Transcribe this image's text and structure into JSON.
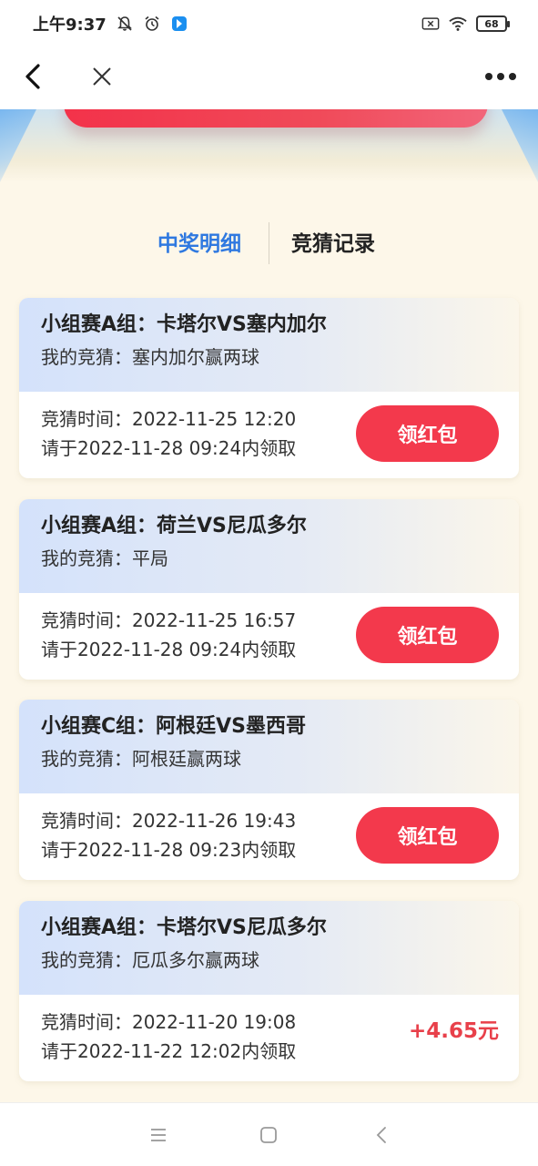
{
  "status_bar": {
    "time": "上午9:37",
    "battery": "68",
    "icons": [
      "bell-off-icon",
      "alarm-icon",
      "app-notification-icon",
      "sim-x-icon",
      "wifi-icon",
      "battery-icon"
    ]
  },
  "nav": {
    "back_icon": "chevron-left-icon",
    "close_icon": "close-icon",
    "more_icon": "more-dots-icon"
  },
  "tabs": [
    {
      "label": "中奖明细",
      "active": true
    },
    {
      "label": "竞猜记录",
      "active": false
    }
  ],
  "colors": {
    "accent_blue": "#2f79e0",
    "claim_red": "#f3394c",
    "amount_red": "#e8404a",
    "page_bg": "#fdf7e9"
  },
  "records": [
    {
      "title": "小组赛A组：卡塔尔VS塞内加尔",
      "guess": "我的竞猜：塞内加尔赢两球",
      "time": "竞猜时间：2022-11-25 12:20",
      "deadline": "请于2022-11-28 09:24内领取",
      "action": "领红包"
    },
    {
      "title": "小组赛A组：荷兰VS尼瓜多尔",
      "guess": "我的竞猜：平局",
      "time": "竞猜时间：2022-11-25 16:57",
      "deadline": "请于2022-11-28 09:24内领取",
      "action": "领红包"
    },
    {
      "title": "小组赛C组：阿根廷VS墨西哥",
      "guess": "我的竞猜：阿根廷赢两球",
      "time": "竞猜时间：2022-11-26 19:43",
      "deadline": "请于2022-11-28 09:23内领取",
      "action": "领红包"
    },
    {
      "title": "小组赛A组：卡塔尔VS尼瓜多尔",
      "guess": "我的竞猜：厄瓜多尔赢两球",
      "time": "竞猜时间：2022-11-20 19:08",
      "deadline": "请于2022-11-22 12:02内领取",
      "amount": "+4.65元"
    }
  ],
  "system_nav": [
    "menu-icon",
    "home-icon",
    "back-icon"
  ]
}
